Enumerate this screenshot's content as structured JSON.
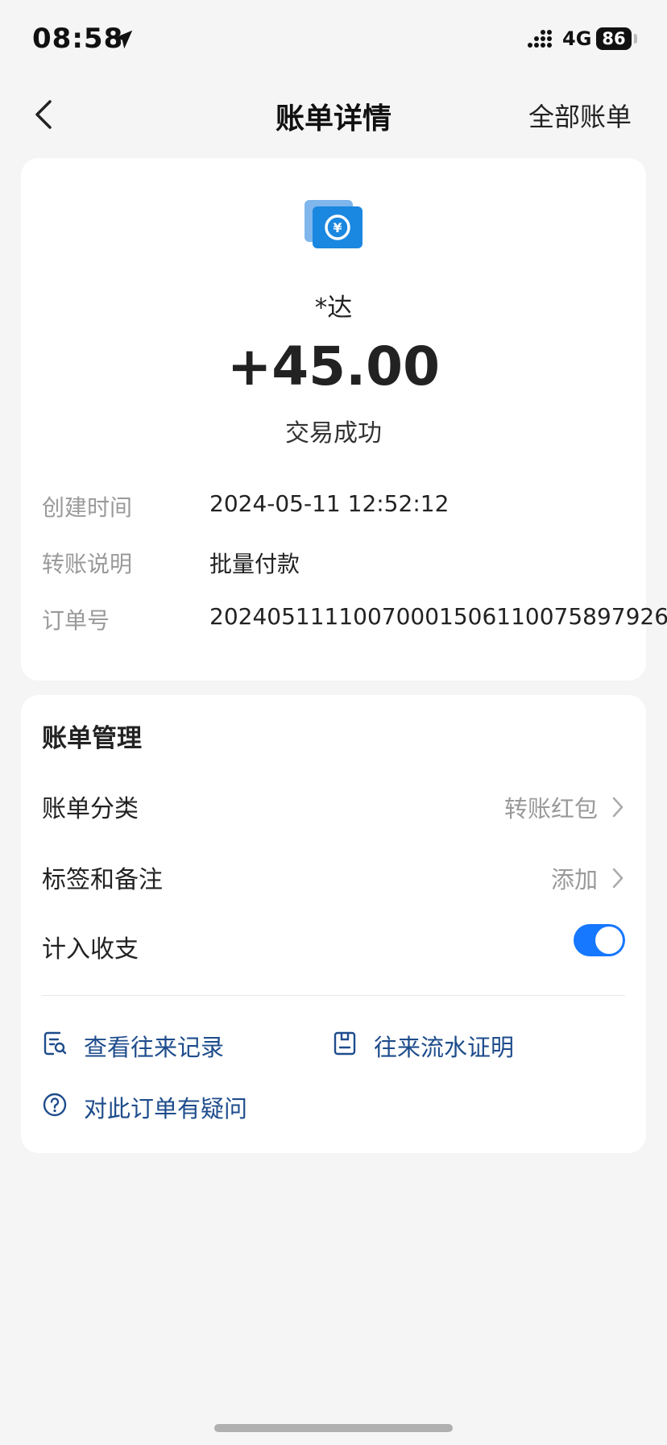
{
  "status_bar": {
    "time": "08:58",
    "network": "4G",
    "battery": "86"
  },
  "nav": {
    "title": "账单详情",
    "right_action": "全部账单"
  },
  "summary": {
    "payee": "*达",
    "amount": "+45.00",
    "status": "交易成功",
    "details": [
      {
        "label": "创建时间",
        "value": "2024-05-11 12:52:12"
      },
      {
        "label": "转账说明",
        "value": "批量付款"
      },
      {
        "label": "订单号",
        "value": "20240511110070001506110075897926"
      }
    ]
  },
  "manage": {
    "title": "账单管理",
    "category": {
      "label": "账单分类",
      "value": "转账红包"
    },
    "tags": {
      "label": "标签和备注",
      "value": "添加"
    },
    "include": {
      "label": "计入收支",
      "enabled": true
    },
    "links": {
      "history": "查看往来记录",
      "proof": "往来流水证明",
      "question": "对此订单有疑问"
    }
  },
  "colors": {
    "accent": "#1677ff",
    "link": "#1e4c8c",
    "background": "#f5f5f5"
  }
}
